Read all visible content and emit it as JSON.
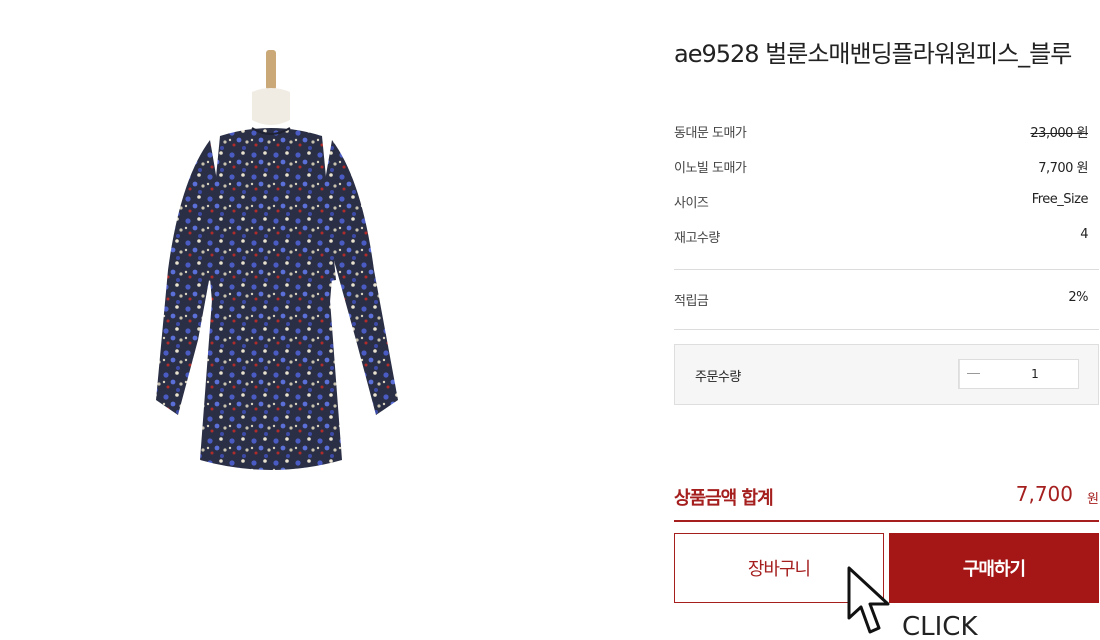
{
  "product": {
    "title": "ae9528 벌룬소매밴딩플라워원피스_블루",
    "image_alt": "floral dress on mannequin"
  },
  "details": [
    {
      "label": "동대문 도매가",
      "value": "23,000 원",
      "style": "strike"
    },
    {
      "label": "이노빌 도매가",
      "value": "7,700 원",
      "style": "red"
    },
    {
      "label": "사이즈",
      "value": "Free_Size",
      "style": "normal"
    },
    {
      "label": "재고수량",
      "value": "4",
      "style": "red"
    }
  ],
  "points": {
    "label": "적립금",
    "value": "2%"
  },
  "quantity": {
    "label": "주문수량",
    "value": "1"
  },
  "total": {
    "label": "상품금액 합계",
    "price": "7,700",
    "unit": "원"
  },
  "buttons": {
    "cart": "장바구니",
    "buy": "구매하기"
  },
  "overlay": {
    "click_text": "CLICK"
  },
  "colors": {
    "accent": "#a51f1f",
    "buy_bg": "#a51717"
  }
}
